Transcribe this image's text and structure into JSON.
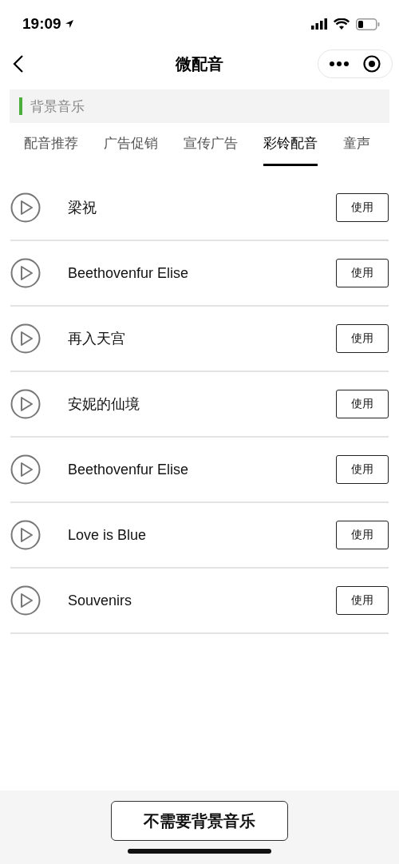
{
  "status_bar": {
    "time": "19:09"
  },
  "nav": {
    "title": "微配音"
  },
  "section": {
    "title": "背景音乐"
  },
  "tabs": [
    {
      "label": "配音推荐",
      "selected": false
    },
    {
      "label": "广告促销",
      "selected": false
    },
    {
      "label": "宣传广告",
      "selected": false
    },
    {
      "label": "彩铃配音",
      "selected": true
    },
    {
      "label": "童声",
      "selected": false
    }
  ],
  "tracks": [
    {
      "title": "梁祝",
      "action": "使用"
    },
    {
      "title": "Beethovenfur Elise",
      "action": "使用"
    },
    {
      "title": "再入天宫",
      "action": "使用"
    },
    {
      "title": "安妮的仙境",
      "action": "使用"
    },
    {
      "title": "Beethovenfur Elise",
      "action": "使用"
    },
    {
      "title": "Love is Blue",
      "action": "使用"
    },
    {
      "title": "Souvenirs",
      "action": "使用"
    }
  ],
  "footer": {
    "button": "不需要背景音乐"
  }
}
